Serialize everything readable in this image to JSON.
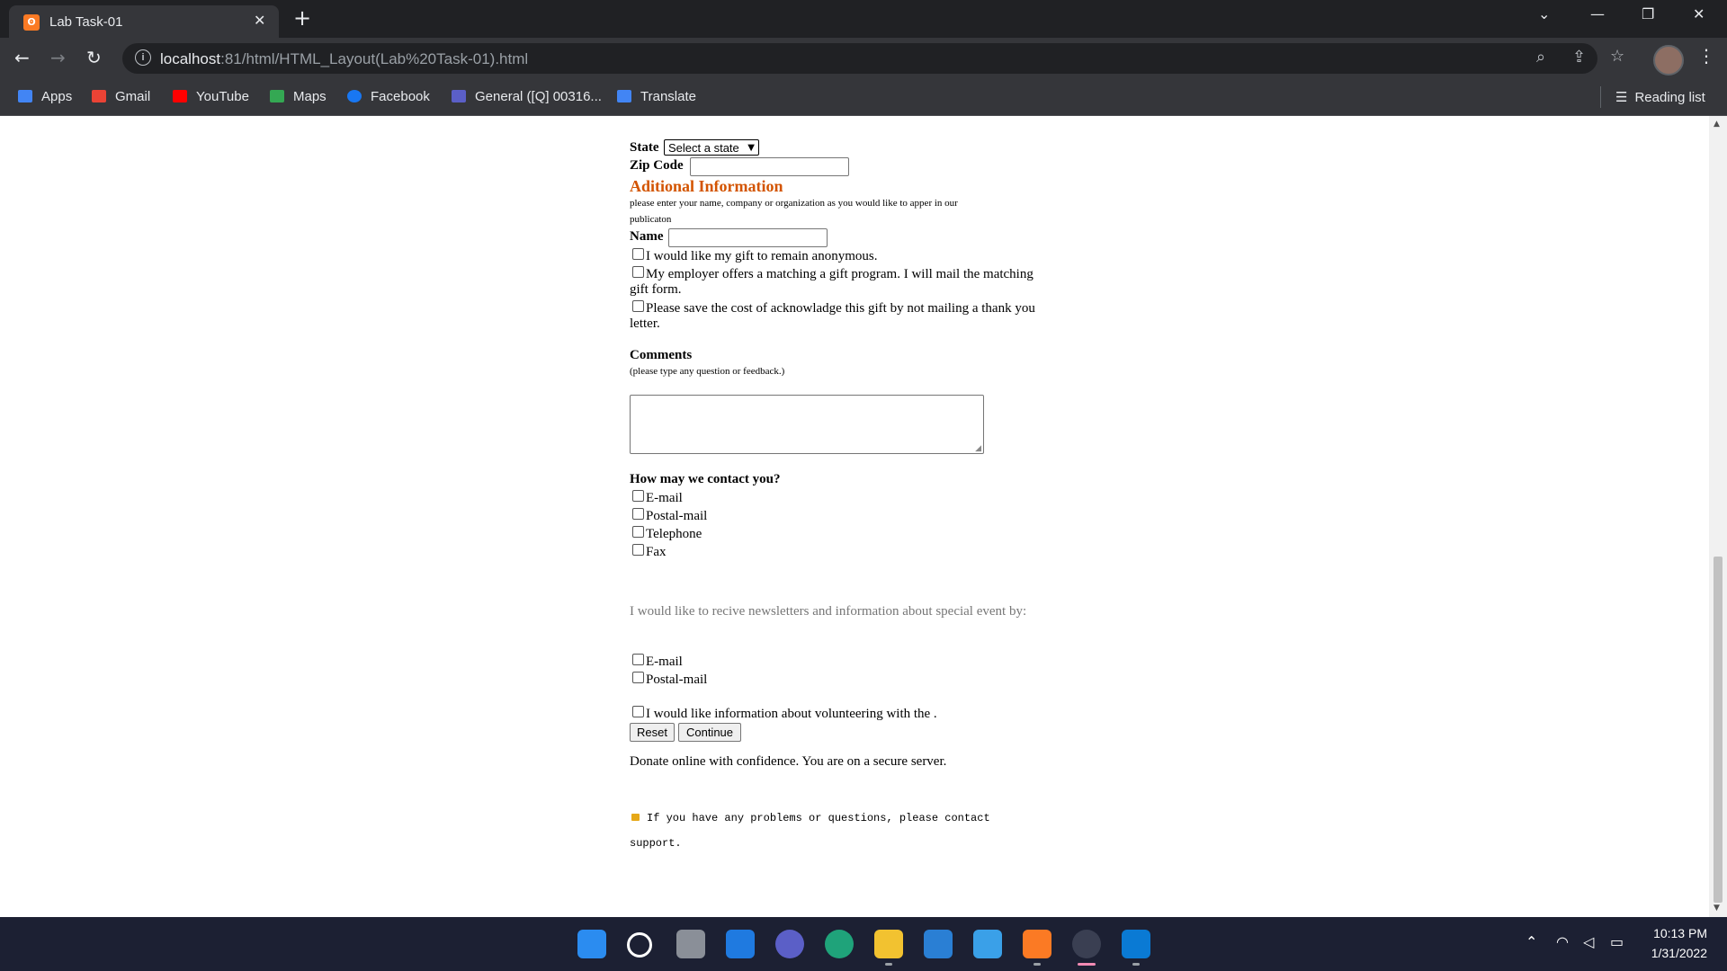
{
  "browser": {
    "tab_title": "Lab Task-01",
    "tab_icon_glyph": "ʘ",
    "url_host": "localhost",
    "url_path": ":81/html/HTML_Layout(Lab%20Task-01).html",
    "bookmarks": [
      {
        "label": "Apps",
        "icon": "apps-grid-icon",
        "color": "#4285f4"
      },
      {
        "label": "Gmail",
        "icon": "gmail-icon",
        "color": "#ea4335"
      },
      {
        "label": "YouTube",
        "icon": "youtube-icon",
        "color": "#ff0000"
      },
      {
        "label": "Maps",
        "icon": "maps-icon",
        "color": "#34a853"
      },
      {
        "label": "Facebook",
        "icon": "facebook-icon",
        "color": "#1877f2"
      },
      {
        "label": "General ([Q] 00316...",
        "icon": "teams-icon",
        "color": "#5b5fc7"
      },
      {
        "label": "Translate",
        "icon": "translate-icon",
        "color": "#4285f4"
      }
    ],
    "reading_list": "Reading list"
  },
  "form": {
    "state_label": "State",
    "state_select": "Select a state",
    "zip_label": "Zip Code",
    "additional_heading": "Aditional Information",
    "additional_note_1": "please enter your name, company or organization as you would like to apper in our",
    "additional_note_2": "publicaton",
    "name_label": "Name",
    "anonymous": "I would like my gift to remain anonymous.",
    "employer_1": "My employer offers a matching a gift program. I will mail the matching",
    "employer_2": "gift form.",
    "save_cost_1": "Please save the cost of acknowladge this gift by not mailing a thank you",
    "save_cost_2": "letter.",
    "comments_label": "Comments",
    "comments_hint": "(please type any question or feedback.)",
    "contact_heading": "How may we contact you?",
    "contact_options": [
      "E-mail",
      "Postal-mail",
      "Telephone",
      "Fax"
    ],
    "newsletter_text": "I would like to recive newsletters and information about special event by:",
    "newsletter_options": [
      "E-mail",
      "Postal-mail"
    ],
    "volunteer": "I would like information about volunteering with the .",
    "reset_label": "Reset",
    "continue_label": "Continue",
    "secure_text": "Donate online with confidence. You are on a secure server.",
    "support_line_1": "If you have any problems or questions, please contact",
    "support_line_2": "support."
  },
  "taskbar": {
    "time": "10:13 PM",
    "date": "1/31/2022"
  }
}
